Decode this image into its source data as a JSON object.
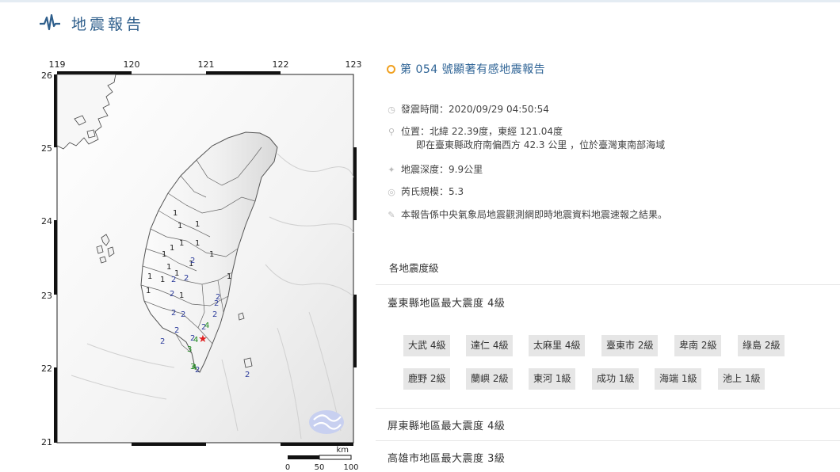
{
  "header": {
    "title": "地震報告"
  },
  "map": {
    "lon_ticks": [
      "119",
      "120",
      "121",
      "122",
      "123"
    ],
    "lat_ticks": [
      "26",
      "25",
      "24",
      "23",
      "22",
      "21"
    ],
    "epicenter_label": "★",
    "scale_unit": "km",
    "scale_ticks": [
      "0",
      "50",
      "100"
    ],
    "station_labels": [
      {
        "v": "1",
        "c": "#222"
      },
      {
        "v": "1",
        "c": "#222"
      },
      {
        "v": "1",
        "c": "#222"
      },
      {
        "v": "1",
        "c": "#222"
      },
      {
        "v": "1",
        "c": "#222"
      },
      {
        "v": "1",
        "c": "#222"
      },
      {
        "v": "1",
        "c": "#222"
      },
      {
        "v": "1",
        "c": "#222"
      },
      {
        "v": "1",
        "c": "#222"
      },
      {
        "v": "1",
        "c": "#222"
      },
      {
        "v": "1",
        "c": "#222"
      },
      {
        "v": "1",
        "c": "#222"
      },
      {
        "v": "1",
        "c": "#222"
      },
      {
        "v": "1",
        "c": "#222"
      },
      {
        "v": "1",
        "c": "#222"
      },
      {
        "v": "1",
        "c": "#222"
      },
      {
        "v": "2",
        "c": "#2a3a9a"
      },
      {
        "v": "2",
        "c": "#2a3a9a"
      },
      {
        "v": "2",
        "c": "#2a3a9a"
      },
      {
        "v": "2",
        "c": "#2a3a9a"
      },
      {
        "v": "2",
        "c": "#2a3a9a"
      },
      {
        "v": "2",
        "c": "#2a3a9a"
      },
      {
        "v": "2",
        "c": "#2a3a9a"
      },
      {
        "v": "2",
        "c": "#2a3a9a"
      },
      {
        "v": "2",
        "c": "#2a3a9a"
      },
      {
        "v": "2",
        "c": "#2a3a9a"
      },
      {
        "v": "2",
        "c": "#2a3a9a"
      },
      {
        "v": "2",
        "c": "#2a3a9a"
      },
      {
        "v": "2",
        "c": "#2a3a9a"
      },
      {
        "v": "2",
        "c": "#2a3a9a"
      },
      {
        "v": "2",
        "c": "#2a3a9a"
      },
      {
        "v": "3",
        "c": "#1e8a1e"
      },
      {
        "v": "3",
        "c": "#1e8a1e"
      },
      {
        "v": "4",
        "c": "#1e8a1e"
      },
      {
        "v": "4",
        "c": "#1e8a1e"
      },
      {
        "v": "4",
        "c": "#1e8a1e"
      }
    ]
  },
  "report": {
    "title": "第 054 號顯著有感地震報告",
    "time": "發震時間：2020/09/29 04:50:54",
    "location": "位置：北緯 22.39度，東經 121.04度",
    "location_detail": "即在臺東縣政府南偏西方 42.3 公里 ，位於臺灣東南部海域",
    "depth": "地震深度：9.9公里",
    "magnitude": "芮氏規模：5.3",
    "note": "本報告係中央氣象局地震觀測網即時地震資料地震速報之結果。"
  },
  "intensity": {
    "heading": "各地震度級",
    "counties": [
      "臺東縣地區最大震度 4級",
      "屏東縣地區最大震度 4級",
      "高雄市地區最大震度 3級"
    ],
    "stations": [
      "大武 4級",
      "達仁 4級",
      "太麻里 4級",
      "臺東市 2級",
      "卑南 2級",
      "綠島 2級",
      "鹿野 2級",
      "蘭嶼 2級",
      "東河 1級",
      "成功 1級",
      "海端 1級",
      "池上 1級"
    ]
  },
  "colors": {
    "header_blue": "#2f5f8c",
    "title_blue": "#2f6496",
    "dot_orange": "#f0a020",
    "chip_bg": "#e6e6e6",
    "epicenter_red": "#e02020",
    "intensity_1": "#222222",
    "intensity_2": "#2a3a9a",
    "intensity_3_4": "#1e8a1e"
  },
  "icons": [
    "seismograph-icon",
    "clock-icon",
    "location-pin-icon",
    "depth-icon",
    "magnitude-icon",
    "pen-icon"
  ]
}
